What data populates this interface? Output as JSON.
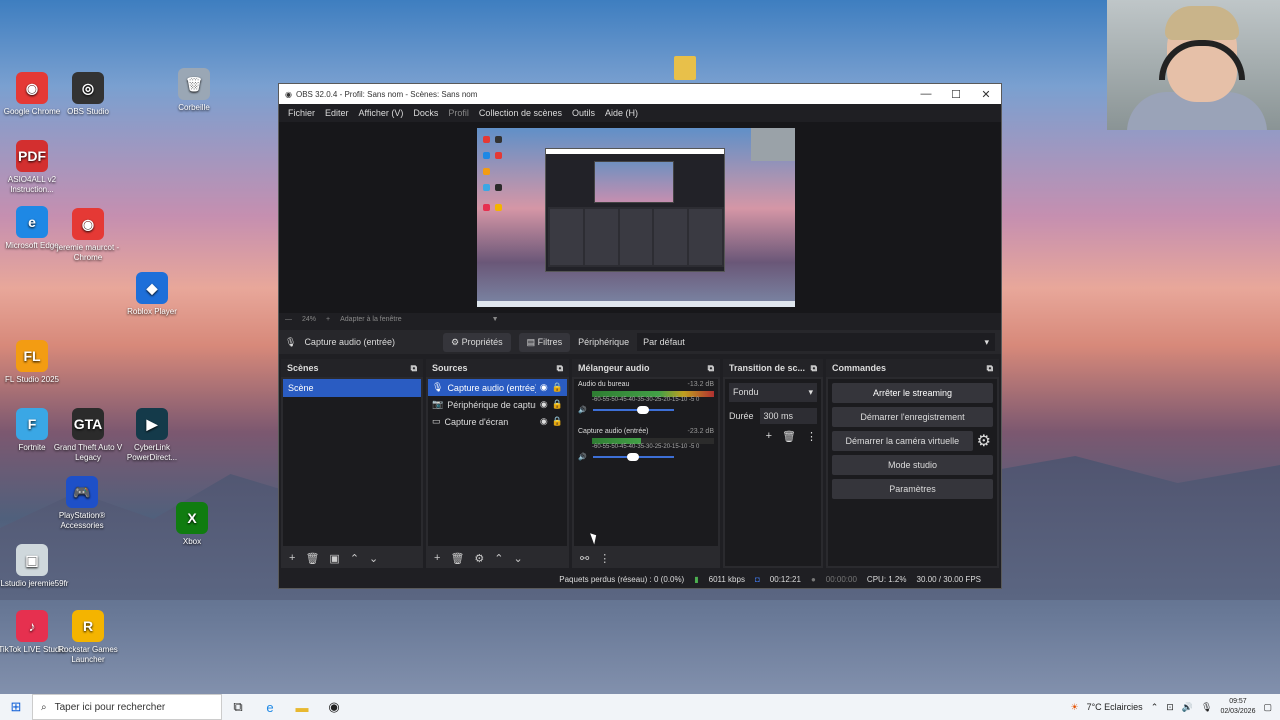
{
  "desktop": {
    "icons": [
      {
        "label": "Google Chrome",
        "glyph": "◉",
        "color": "#e53935"
      },
      {
        "label": "OBS Studio",
        "glyph": "◎",
        "color": "#333333"
      },
      {
        "label": "Corbeille",
        "glyph": "🗑",
        "color": "#9aa7b5"
      },
      {
        "label": "ASIO4ALL v2 Instruction...",
        "glyph": "PDF",
        "color": "#d32f2f"
      },
      {
        "label": "Microsoft Edge",
        "glyph": "e",
        "color": "#1e88e5"
      },
      {
        "label": "jeremie maurcot - Chrome",
        "glyph": "◉",
        "color": "#e53935"
      },
      {
        "label": "Roblox Player",
        "glyph": "◆",
        "color": "#1e6fd9"
      },
      {
        "label": "FL Studio 2025",
        "glyph": "FL",
        "color": "#f39c12"
      },
      {
        "label": "Fortnite",
        "glyph": "F",
        "color": "#3aa7e5"
      },
      {
        "label": "Grand Theft Auto V Legacy",
        "glyph": "GTA",
        "color": "#2b2b2b"
      },
      {
        "label": "CyberLink PowerDirect...",
        "glyph": "▶",
        "color": "#143a4a"
      },
      {
        "label": "PlayStation® Accessories",
        "glyph": "🎮",
        "color": "#1e50c8"
      },
      {
        "label": "Xbox",
        "glyph": "X",
        "color": "#107c10"
      },
      {
        "label": "FLstudio jeremie59fr",
        "glyph": "▣",
        "color": "#cfd8dc"
      },
      {
        "label": "TikTok LIVE Studio",
        "glyph": "♪",
        "color": "#e6304f"
      },
      {
        "label": "Rockstar Games Launcher",
        "glyph": "R",
        "color": "#f4b400"
      }
    ]
  },
  "obs": {
    "title": "OBS 32.0.4 - Profil: Sans nom - Scènes: Sans nom",
    "menu": [
      "Fichier",
      "Editer",
      "Afficher (V)",
      "Docks",
      "Profil",
      "Collection de scènes",
      "Outils",
      "Aide (H)"
    ],
    "zoom": "24%",
    "fit": "Adapter à la fenêtre",
    "source_name": "Capture audio (entrée)",
    "properties": "Propriétés",
    "filters": "Filtres",
    "device_label": "Périphérique",
    "device_value": "Par défaut",
    "scenes": {
      "title": "Scènes",
      "items": [
        "Scène"
      ]
    },
    "sources": {
      "title": "Sources",
      "items": [
        "Capture audio (entrée)",
        "Périphérique de capture vidéo",
        "Capture d'écran"
      ]
    },
    "mixer": {
      "title": "Mélangeur audio",
      "ticks": "-60-55-50-45-40-35-30-25-20-15-10 -5  0",
      "channels": [
        {
          "name": "Audio du bureau",
          "db": "-13.2 dB",
          "level": 0.78,
          "volume": 0.55
        },
        {
          "name": "Capture audio (entrée)",
          "db": "-23.2 dB",
          "level": 0.4,
          "volume": 0.42
        }
      ]
    },
    "transition": {
      "title": "Transition de sc...",
      "type": "Fondu",
      "duration_label": "Durée",
      "duration": "300 ms"
    },
    "commands": {
      "title": "Commandes",
      "buttons": [
        "Arrêter le streaming",
        "Démarrer l'enregistrement",
        "Démarrer la caméra virtuelle",
        "Mode studio",
        "Paramètres"
      ]
    },
    "status": {
      "dropped": "Paquets perdus (réseau) : 0 (0.0%)",
      "bitrate": "6011 kbps",
      "stream_time": "00:12:21",
      "rec_time": "00:00:00",
      "cpu": "CPU: 1.2%",
      "fps": "30.00 / 30.00 FPS"
    }
  },
  "taskbar": {
    "search": "Taper ici pour rechercher",
    "weather": "7°C  Eclaircies",
    "time": "09:57",
    "date": "02/03/2026"
  }
}
